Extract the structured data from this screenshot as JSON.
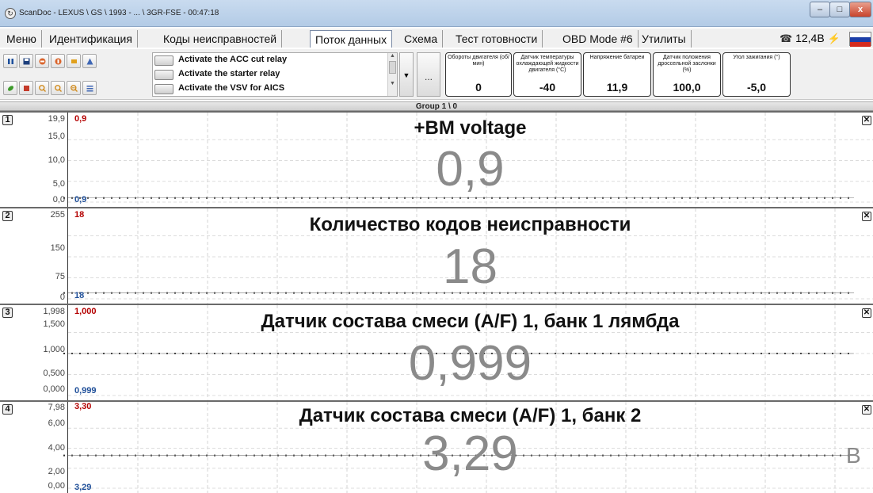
{
  "window": {
    "title": "ScanDoc - LEXUS \\ GS \\ 1993 - ... \\ 3GR-FSE - 00:47:18",
    "min_glyph": "–",
    "max_glyph": "□",
    "close_glyph": "x"
  },
  "menu": {
    "tabs": [
      "Меню",
      "Идентификация",
      "Коды неисправностей",
      "Поток данных",
      "Схема",
      "Тест готовности",
      "OBD Mode #6",
      "Утилиты"
    ],
    "active_tab": "Поток данных"
  },
  "status": {
    "battery": "12,4В",
    "phone_icon": "phone-icon",
    "plug_icon": "plug-icon",
    "flag": [
      "#ffffff",
      "#1c3fa8",
      "#d52b1e"
    ]
  },
  "actuators": {
    "items": [
      "Activate the ACC cut relay",
      "Activate the starter relay",
      "Activate the VSV for AICS"
    ],
    "more_label": "..."
  },
  "gauges": [
    {
      "label": "Обороты двигателя (об/мин)",
      "value": "0"
    },
    {
      "label": "Датчик температуры охлаждающей жидкости двигателя (°C)",
      "value": "-40"
    },
    {
      "label": "Напряжение батареи",
      "value": "11,9"
    },
    {
      "label": "Датчик положения дроссельной заслонки (%)",
      "value": "100,0"
    },
    {
      "label": "Угол зажигания (°)",
      "value": "-5,0"
    }
  ],
  "group": "Group 1 \\ 0",
  "panels": [
    {
      "num": "1",
      "title": "+BM voltage",
      "value": "0,9",
      "top_value": "0,9",
      "bottom_value": "0,9",
      "ticks": [
        "19,9",
        "15,0",
        "10,0",
        "5,0",
        "0,0"
      ],
      "trace_fraction": 0.05,
      "side": ""
    },
    {
      "num": "2",
      "title": "Количество кодов неисправности",
      "value": "18",
      "top_value": "18",
      "bottom_value": "18",
      "ticks": [
        "255",
        "150",
        "75",
        "0"
      ],
      "trace_fraction": 0.07,
      "side": ""
    },
    {
      "num": "3",
      "title": "Датчик состава смеси (A/F) 1, банк 1 лямбда",
      "value": "0,999",
      "top_value": "1,000",
      "bottom_value": "0,999",
      "ticks": [
        "1,998",
        "1,500",
        "1,000",
        "0,500",
        "0,000"
      ],
      "trace_fraction": 0.5,
      "side": ""
    },
    {
      "num": "4",
      "title": "Датчик состава смеси (A/F) 1, банк 2",
      "value": "3,29",
      "top_value": "3,30",
      "bottom_value": "3,29",
      "ticks": [
        "7,98",
        "6,00",
        "4,00",
        "2,00",
        "0,00"
      ],
      "trace_fraction": 0.41,
      "side": "В"
    }
  ],
  "toolbar_icons": [
    "pause-icon",
    "save-icon",
    "car-in-icon",
    "car-out-icon",
    "car-export-icon",
    "chart-tool-icon",
    "leaf-icon",
    "export-icon",
    "zoom-in-icon",
    "zoom-out-icon",
    "zoom-fit-icon",
    "list-icon"
  ]
}
